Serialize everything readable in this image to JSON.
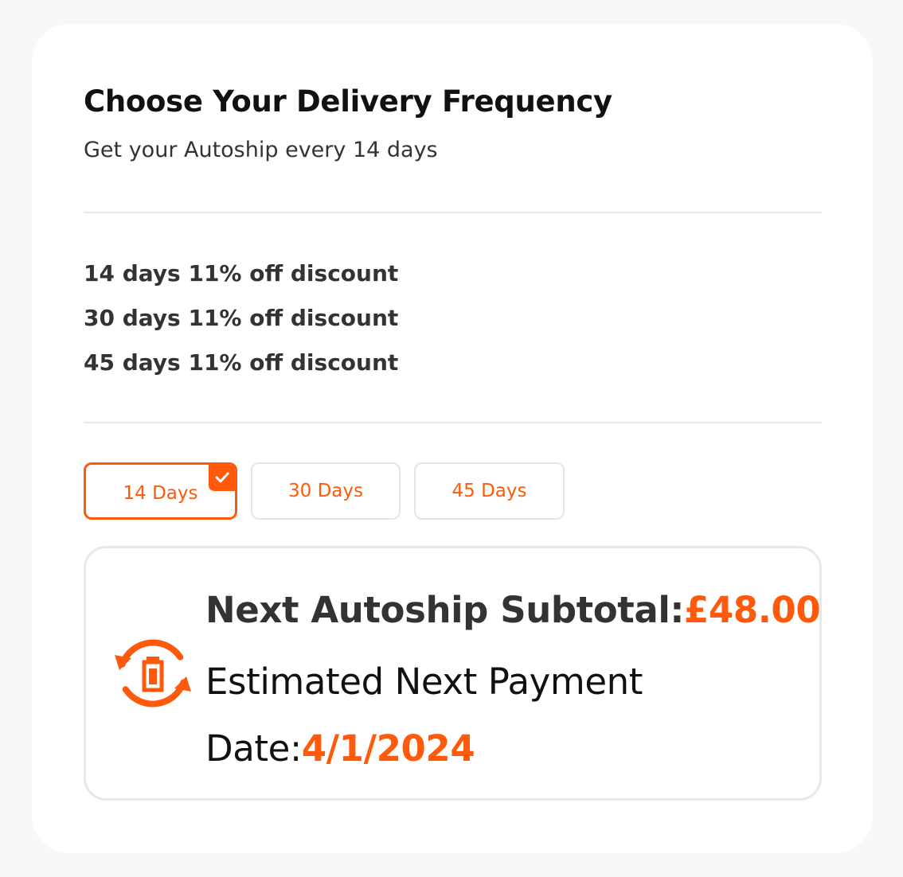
{
  "header": {
    "title": "Choose Your Delivery Frequency",
    "subtitle": "Get your Autoship every 14 days"
  },
  "discounts": [
    "14 days 11% off discount",
    "30 days 11% off discount",
    "45 days 11% off discount"
  ],
  "frequency_options": [
    {
      "label": "14 Days",
      "selected": true
    },
    {
      "label": "30 Days",
      "selected": false
    },
    {
      "label": "45 Days",
      "selected": false
    }
  ],
  "summary": {
    "subtotal_label": "Next Autoship Subtotal:",
    "subtotal_value": "£48.00",
    "payment_label": "Estimated Next Payment Date:",
    "payment_value": "4/1/2024",
    "icon": "autoship-sync-icon"
  },
  "colors": {
    "accent": "#ff5a0c",
    "border": "#e8e8e8",
    "heading": "#111111",
    "text": "#333333"
  }
}
